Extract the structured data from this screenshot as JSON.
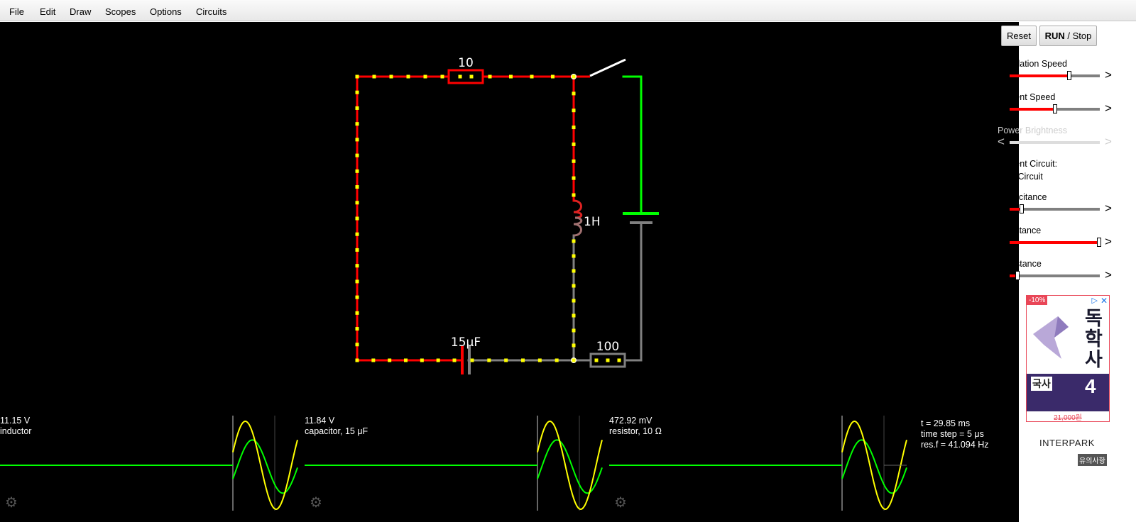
{
  "menu": {
    "items": [
      "File",
      "Edit",
      "Draw",
      "Scopes",
      "Options",
      "Circuits"
    ]
  },
  "circuit": {
    "resistor_top": "10",
    "resistor_bottom": "100",
    "capacitor": "15μF",
    "inductor": "1H"
  },
  "scopes": [
    {
      "value": "11.15 V",
      "name": "inductor"
    },
    {
      "value": "11.84 V",
      "name": "capacitor, 15 μF"
    },
    {
      "value": "472.92 mV",
      "name": "resistor, 10 Ω"
    }
  ],
  "info": {
    "time": "t = 29.85 ms",
    "time_step": "time step = 5 μs",
    "res_f": "res.f = 41.094 Hz"
  },
  "sidebar": {
    "reset_label": "Reset",
    "run_label": "RUN",
    "stop_label": " / Stop",
    "sim_speed_label": "Simulation Speed",
    "current_speed_label": "Current Speed",
    "power_brightness_label": "Power Brightness",
    "current_circuit_label": "Current Circuit:",
    "current_circuit_value": "LRC Circuit",
    "capacitance_label": "Capacitance",
    "inductance_label": "Inductance",
    "resistance_label": "Resistance",
    "arrow_left": "<",
    "arrow_right": ">",
    "sliders": {
      "sim_speed": 0.66,
      "current_speed": 0.5,
      "power_brightness": 0.5,
      "capacitance": 0.13,
      "inductance": 0.99,
      "resistance": 0.09
    }
  },
  "ad": {
    "discount": "-10%",
    "title": "독학사",
    "subject": "국사",
    "number": "4",
    "price": "21,000원",
    "brand": "INTERPARK",
    "notice": "유의사항",
    "close": "✕",
    "flag": "▷"
  },
  "colors": {
    "wire_active": "#ff0000",
    "wire_idle": "#808080",
    "wire_voltage": "#00ff00",
    "current_dot": "#ffff00",
    "scope_voltage": "#00ff00",
    "scope_current": "#ffff00",
    "background": "#000000"
  },
  "icons": {
    "scope_settings": "gear-icon"
  }
}
